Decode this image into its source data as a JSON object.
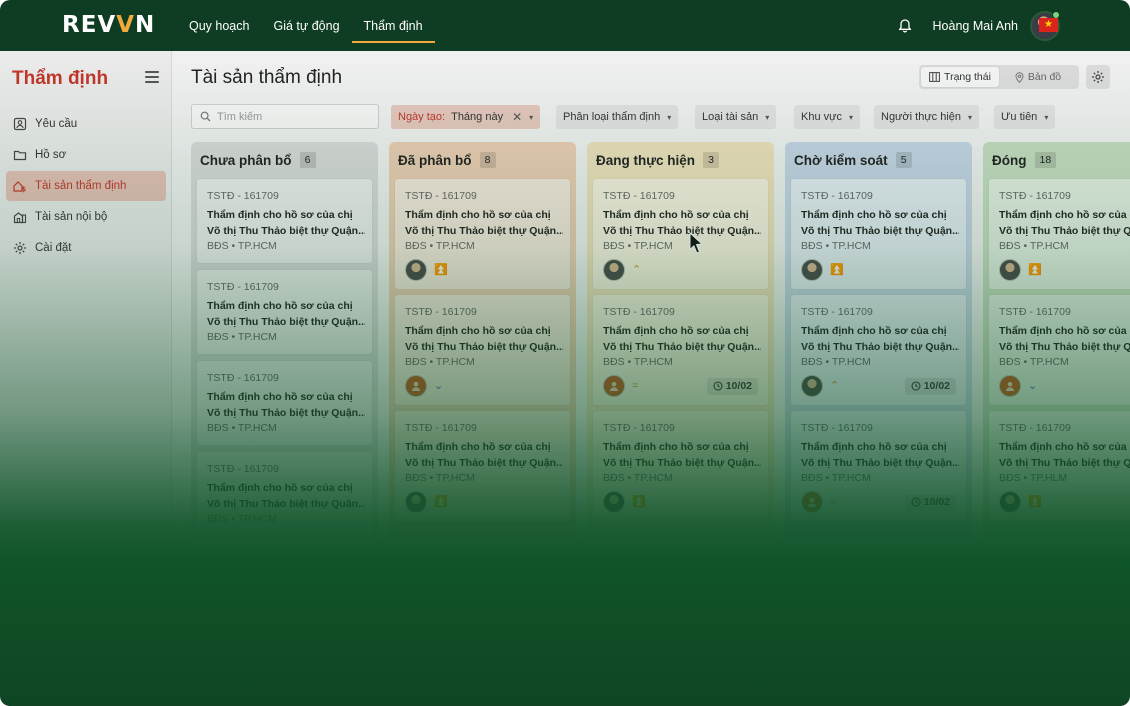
{
  "header": {
    "logo_main": "REV",
    "logo_accent": "V",
    "logo_tail": "N",
    "nav": [
      {
        "label": "Quy hoạch"
      },
      {
        "label": "Giá tự động"
      },
      {
        "label": "Thẩm định"
      }
    ],
    "active_nav": 2,
    "username": "Hoàng Mai Anh",
    "flag_glyph": "★"
  },
  "sidebar": {
    "title": "Thẩm định",
    "items": [
      {
        "label": "Yêu cầu",
        "icon": "request-icon"
      },
      {
        "label": "Hồ sơ",
        "icon": "folder-icon"
      },
      {
        "label": "Tài sản thẩm định",
        "icon": "asset-appraisal-icon"
      },
      {
        "label": "Tài sản nội bộ",
        "icon": "building-icon"
      },
      {
        "label": "Cài đặt",
        "icon": "gear-icon"
      }
    ],
    "active_index": 2
  },
  "main": {
    "title": "Tài sản thẩm định",
    "view_toggle": {
      "status_label": "Trạng thái",
      "map_label": "Bản đồ"
    },
    "search_placeholder": "Tìm kiếm",
    "filters": {
      "created_label": "Ngày tạo:",
      "created_value": "Tháng này",
      "classification": "Phân loại thẩm định",
      "asset_type": "Loại tài sản",
      "region": "Khu vực",
      "assignee": "Người thực hiện",
      "priority": "Ưu tiên"
    }
  },
  "colors": {
    "brand_dark": "#0f3d24",
    "accent_orange": "#f2a93b",
    "active_red": "#c3362b",
    "col_unassigned": "#d9d9d9",
    "col_assigned": "#eccdb4",
    "col_in_progress": "#efe0bd",
    "col_review": "#c6d4e6",
    "col_closed": "#c6dcc1"
  },
  "board": {
    "columns": [
      {
        "title": "Chưa phân bổ",
        "count": "6",
        "cards": [
          {
            "code": "TSTĐ - 161709",
            "desc1": "Thẩm định cho hồ sơ của chị",
            "desc2": "Võ thị Thu Thảo biệt thự Quận...",
            "meta": "BĐS • TP.HCM"
          },
          {
            "code": "TSTĐ - 161709",
            "desc1": "Thẩm định cho hồ sơ của chị",
            "desc2": "Võ thị Thu Thảo biệt thự Quận...",
            "meta": "BĐS • TP.HCM"
          },
          {
            "code": "TSTĐ - 161709",
            "desc1": "Thẩm định cho hồ sơ của chị",
            "desc2": "Võ thị Thu Thảo biệt thự Quận...",
            "meta": "BĐS • TP.HCM"
          },
          {
            "code": "TSTĐ - 161709",
            "desc1": "Thẩm định cho hồ sơ của chị",
            "desc2": "Võ thị Thu Thảo biệt thự Quận...",
            "meta": "BĐS • TP.HCM"
          }
        ]
      },
      {
        "title": "Đã phân bổ",
        "count": "8",
        "cards": [
          {
            "code": "TSTĐ - 161709",
            "desc1": "Thẩm định cho hồ sơ của chị",
            "desc2": "Võ thị Thu Thảo biệt thự Quận...",
            "meta": "BĐS • TP.HCM",
            "priority": "⏫"
          },
          {
            "code": "TSTĐ - 161709",
            "desc1": "Thẩm định cho hồ sơ của chị",
            "desc2": "Võ thị Thu Thảo biệt thự Quận...",
            "meta": "BĐS • TP.HCM",
            "priority": "⌄"
          },
          {
            "code": "TSTĐ - 161709",
            "desc1": "Thẩm định cho hồ sơ của chị",
            "desc2": "Võ thị Thu Thảo biệt thự Quận...",
            "meta": "BĐS • TP.HCM",
            "priority": "⏫"
          }
        ]
      },
      {
        "title": "Đang thực hiện",
        "count": "3",
        "cards": [
          {
            "code": "TSTĐ - 161709",
            "desc1": "Thẩm định cho hồ sơ của chị",
            "desc2": "Võ thị Thu Thảo biệt thự Quận...",
            "meta": "BĐS • TP.HCM",
            "priority": "⌃"
          },
          {
            "code": "TSTĐ - 161709",
            "desc1": "Thẩm định cho hồ sơ của chị",
            "desc2": "Võ thị Thu Thảo biệt thự Quận...",
            "meta": "BĐS • TP.HCM",
            "priority": "=",
            "due": "10/02"
          },
          {
            "code": "TSTĐ - 161709",
            "desc1": "Thẩm định cho hồ sơ của chị",
            "desc2": "Võ thị Thu Thảo biệt thự Quận...",
            "meta": "BĐS • TP.HCM",
            "priority": "⏫"
          }
        ]
      },
      {
        "title": "Chờ kiểm soát",
        "count": "5",
        "cards": [
          {
            "code": "TSTĐ - 161709",
            "desc1": "Thẩm định cho hồ sơ của chị",
            "desc2": "Võ thị Thu Thảo biệt thự Quận...",
            "meta": "BĐS • TP.HCM",
            "priority": "⏫"
          },
          {
            "code": "TSTĐ - 161709",
            "desc1": "Thẩm định cho hồ sơ của chị",
            "desc2": "Võ thị Thu Thảo biệt thự Quận...",
            "meta": "BĐS • TP.HCM",
            "priority": "⌃",
            "due": "10/02"
          },
          {
            "code": "TSTĐ - 161709",
            "desc1": "Thẩm định cho hồ sơ của chị",
            "desc2": "Võ thị Thu Thảo biệt thự Quận...",
            "meta": "BĐS • TP.HCM",
            "priority": "=",
            "due": "10/02"
          }
        ]
      },
      {
        "title": "Đóng",
        "count": "18",
        "cards": [
          {
            "code": "TSTĐ - 161709",
            "desc1": "Thẩm định cho hồ sơ của chị",
            "desc2": "Võ thị Thu Thảo biệt thự Quận...",
            "meta": "BĐS • TP.HCM",
            "priority": "⏫"
          },
          {
            "code": "TSTĐ - 161709",
            "desc1": "Thẩm định cho hồ sơ của chị",
            "desc2": "Võ thị Thu Thảo biệt thự Quận...",
            "meta": "BĐS • TP.HCM",
            "priority": "⌄"
          },
          {
            "code": "TSTĐ - 161709",
            "desc1": "Thẩm định cho hồ sơ của chị",
            "desc2": "Võ thị Thu Thảo biệt thự Quận...",
            "meta": "BĐS • TP.HLM",
            "priority": "⏫"
          }
        ]
      }
    ]
  }
}
